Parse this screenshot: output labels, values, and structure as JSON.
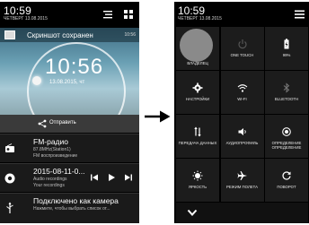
{
  "left": {
    "status": {
      "time": "10:59",
      "date": "ЧЕТВЕРГ 13.08.2015"
    },
    "screenshot": {
      "title": "Скриншот сохранен",
      "time_small": "10:56",
      "clock_time": "10:56",
      "clock_date": "13.08.2015, чт"
    },
    "share_label": "Отправить",
    "notifications": [
      {
        "title": "FM-радио",
        "line1": "87.8MHz(Station1)",
        "line2": "FM воспроизведение"
      },
      {
        "title": "2015-08-11-0...",
        "line1": "Audio recordings",
        "line2": "Your recordings"
      },
      {
        "title": "Подключено как камера",
        "line1": "Нажмите, чтобы выбрать список от...",
        "line2": ""
      }
    ]
  },
  "right": {
    "status": {
      "time": "10:59",
      "date": "ЧЕТВЕРГ 13.08.2015"
    },
    "tiles": [
      {
        "label": "ВЛАДЕЛЕЦ",
        "icon": "owner-avatar-icon"
      },
      {
        "label": "ONE TOUCH",
        "icon": "power-icon"
      },
      {
        "label": "99%",
        "icon": "battery-icon"
      },
      {
        "label": "НАСТРОЙКИ",
        "icon": "settings-gear-icon"
      },
      {
        "label": "WI-FI",
        "icon": "wifi-icon"
      },
      {
        "label": "BLUETOOTH",
        "icon": "bluetooth-icon"
      },
      {
        "label": "ПЕРЕДАЧА ДАННЫХ",
        "icon": "data-transfer-icon"
      },
      {
        "label": "АУДИОПРОФИЛЬ",
        "icon": "audio-profile-icon"
      },
      {
        "label": "ОПРЕДЕЛЕНИЕ ОПРЕДЕЛЕНИЕ",
        "icon": "location-icon"
      },
      {
        "label": "ЯРКОСТЬ",
        "icon": "brightness-icon"
      },
      {
        "label": "РЕЖИМ ПОЛЕТА",
        "icon": "airplane-icon"
      },
      {
        "label": "ПОВОРОТ",
        "icon": "rotate-icon"
      }
    ]
  }
}
